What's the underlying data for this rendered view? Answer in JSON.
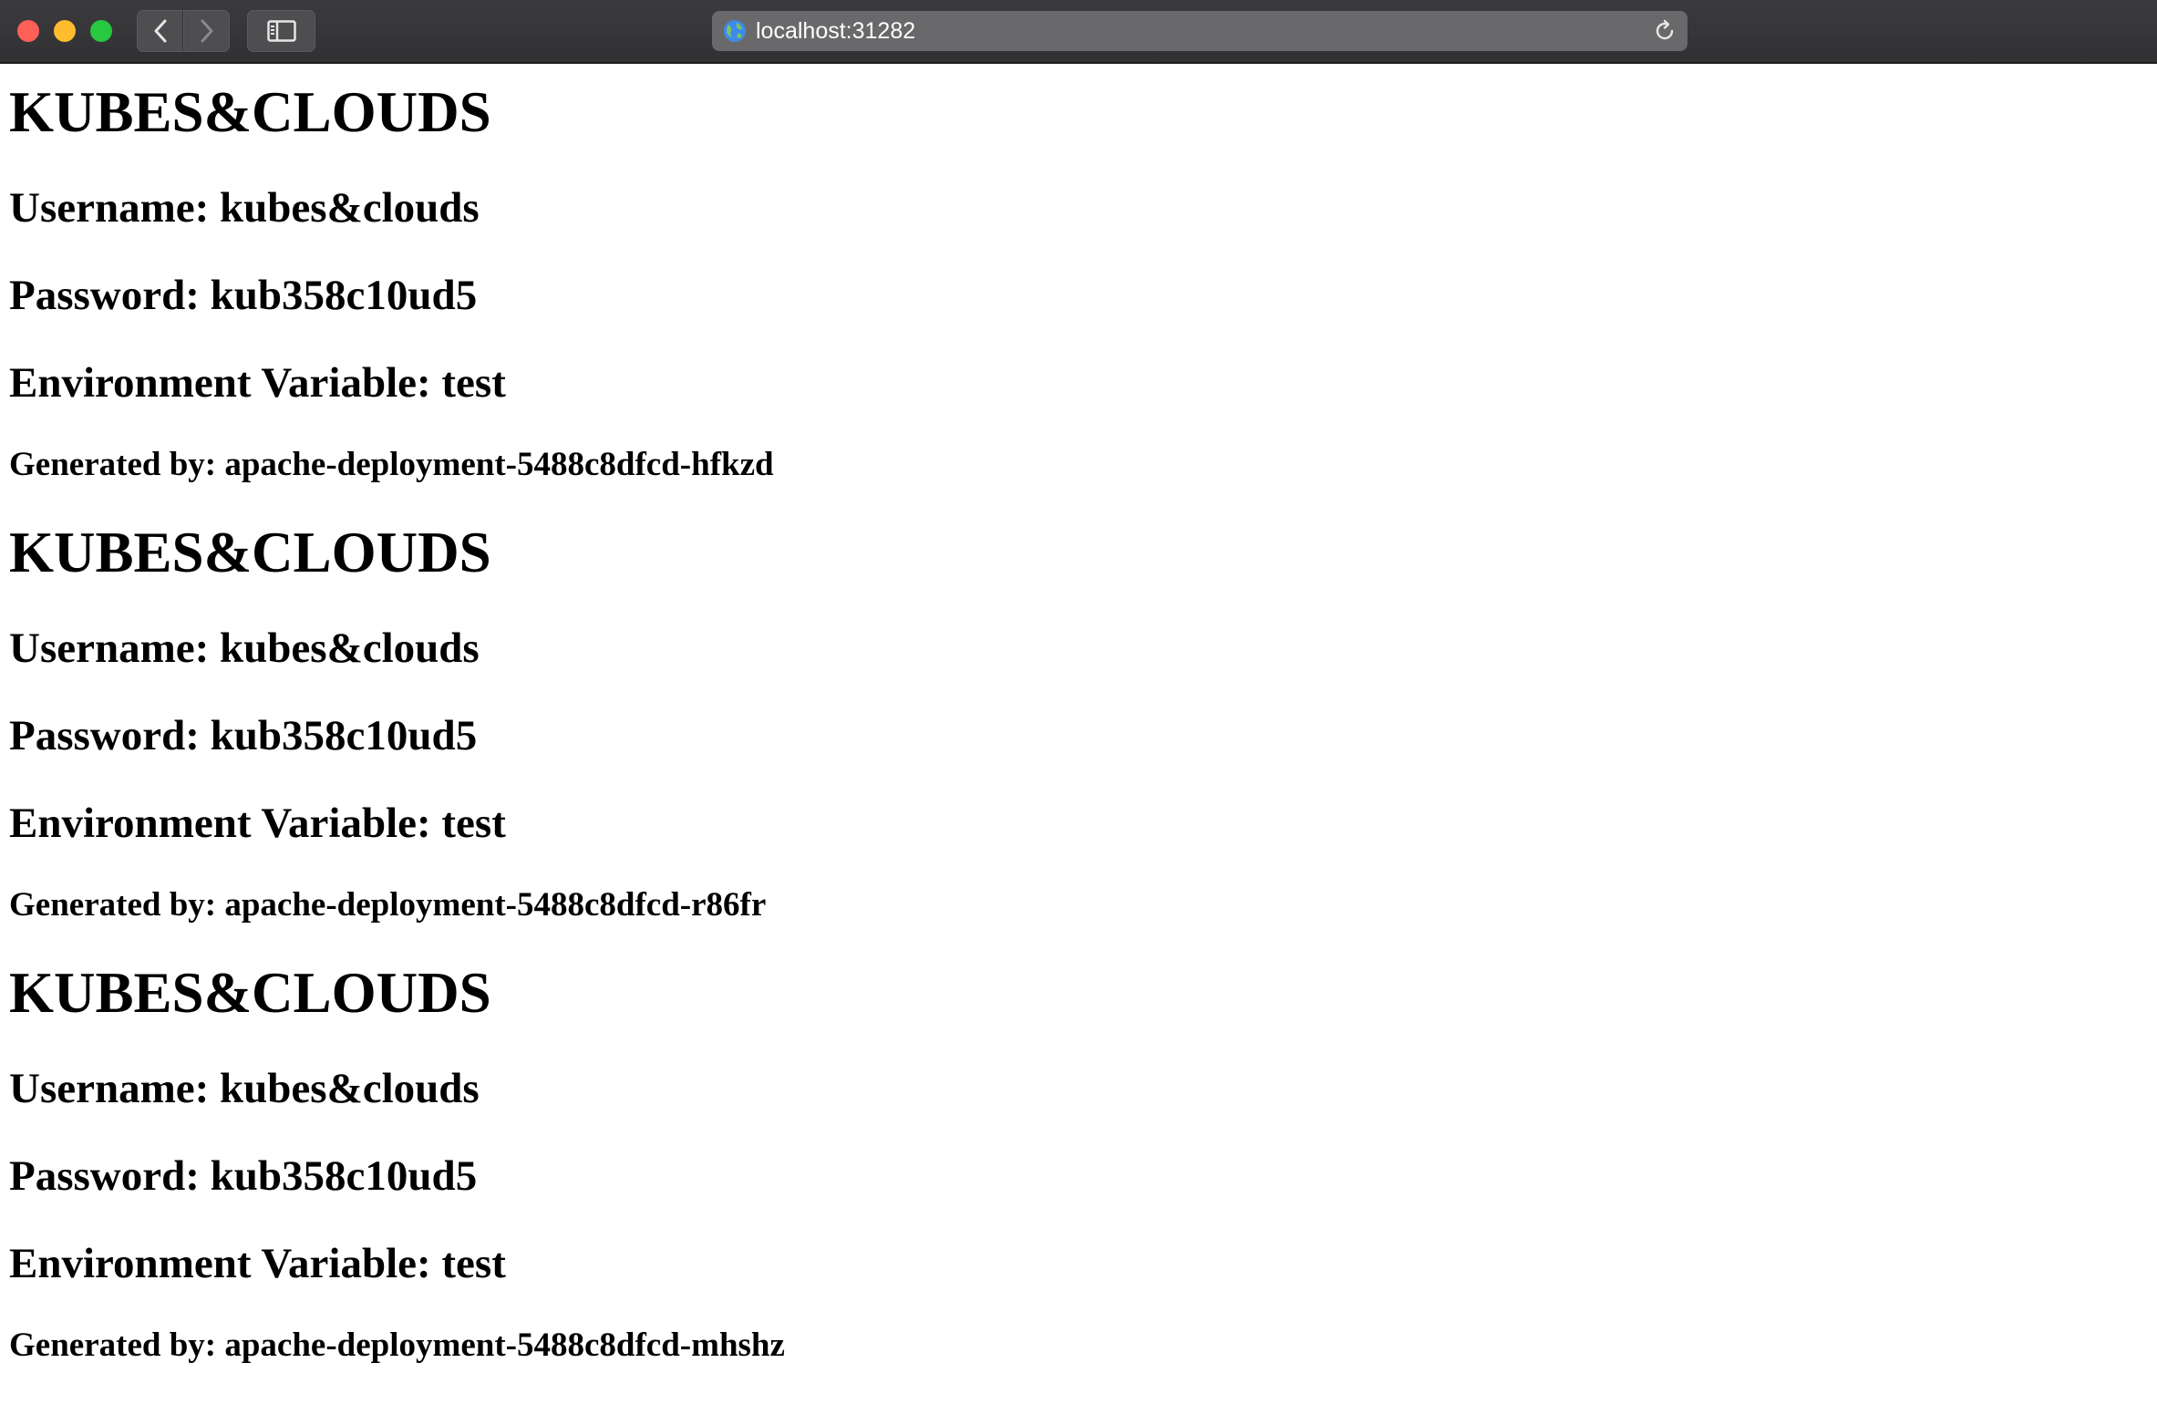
{
  "browser": {
    "url": "localhost:31282"
  },
  "sections": [
    {
      "title": "KUBES&CLOUDS",
      "username": "Username: kubes&clouds",
      "password": "Password: kub358c10ud5",
      "env": "Environment Variable: test",
      "generated": "Generated by: apache-deployment-5488c8dfcd-hfkzd"
    },
    {
      "title": "KUBES&CLOUDS",
      "username": "Username: kubes&clouds",
      "password": "Password: kub358c10ud5",
      "env": "Environment Variable: test",
      "generated": "Generated by: apache-deployment-5488c8dfcd-r86fr"
    },
    {
      "title": "KUBES&CLOUDS",
      "username": "Username: kubes&clouds",
      "password": "Password: kub358c10ud5",
      "env": "Environment Variable: test",
      "generated": "Generated by: apache-deployment-5488c8dfcd-mhshz"
    }
  ]
}
